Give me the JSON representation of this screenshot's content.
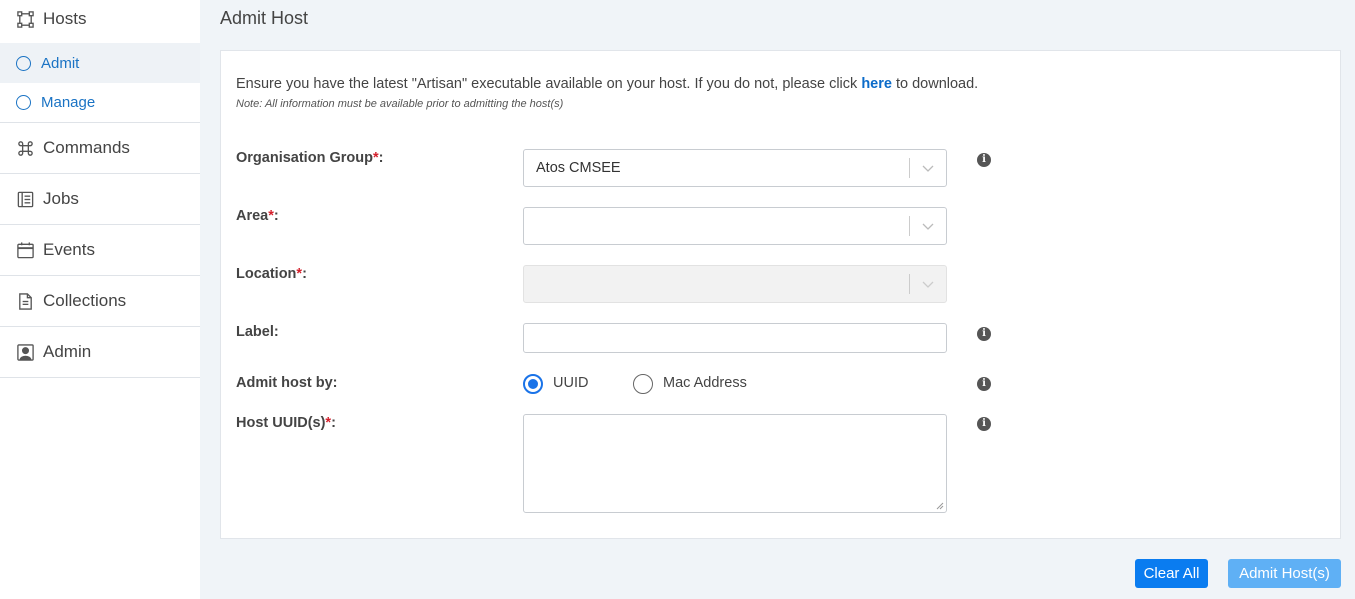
{
  "sidebar": {
    "hosts": {
      "label": "Hosts",
      "icon": "hosts-square-icon"
    },
    "sub_items": [
      {
        "label": "Admit",
        "active": true
      },
      {
        "label": "Manage",
        "active": false
      }
    ],
    "items": [
      {
        "label": "Commands",
        "icon": "command-icon"
      },
      {
        "label": "Jobs",
        "icon": "list-icon"
      },
      {
        "label": "Events",
        "icon": "calendar-icon"
      },
      {
        "label": "Collections",
        "icon": "document-icon"
      },
      {
        "label": "Admin",
        "icon": "user-portrait-icon"
      }
    ]
  },
  "page": {
    "title": "Admit Host",
    "intro_before": "Ensure you have the latest \"Artisan\" executable available on your host. If you do not, please click ",
    "intro_link": "here",
    "intro_after": " to download.",
    "note": "Note: All information must be available prior to admitting the host(s)"
  },
  "form": {
    "org_group": {
      "label": "Organisation Group",
      "required_mark": "*",
      "suffix": ":",
      "value": "Atos CMSEE"
    },
    "area": {
      "label": "Area",
      "required_mark": "*",
      "suffix": ":",
      "value": ""
    },
    "location": {
      "label": "Location",
      "required_mark": "*",
      "suffix": ":",
      "value": "",
      "disabled": true
    },
    "label_field": {
      "label": "Label:",
      "value": ""
    },
    "admit_by": {
      "label": "Admit host by:",
      "options": [
        "UUID",
        "Mac Address"
      ],
      "selected": "UUID"
    },
    "host_uuids": {
      "label": "Host UUID(s)",
      "required_mark": "*",
      "suffix": ":",
      "value": ""
    },
    "info_glyph": "i"
  },
  "actions": {
    "clear_label": "Clear All",
    "admit_label": "Admit Host(s)"
  },
  "colors": {
    "primary": "#0a7cf0",
    "primary_light": "#5fb0f5",
    "required": "#d4202c",
    "link": "#0b6bc9"
  }
}
